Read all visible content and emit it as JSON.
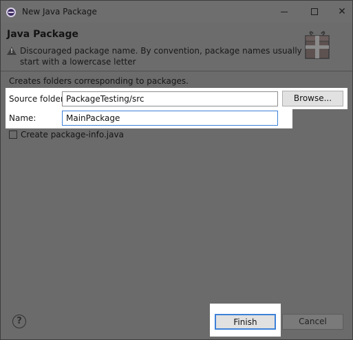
{
  "window": {
    "title": "New Java Package"
  },
  "header": {
    "title": "Java Package",
    "message": "Discouraged package name. By convention, package names usually start with a lowercase letter"
  },
  "body": {
    "description": "Creates folders corresponding to packages.",
    "source_folder_label": "Source folder:",
    "source_folder_value": "PackageTesting/src",
    "browse_label": "Browse...",
    "name_label": "Name:",
    "name_value": "MainPackage",
    "create_package_info_label": "Create package-info.java",
    "create_package_info_checked": false
  },
  "footer": {
    "finish_label": "Finish",
    "cancel_label": "Cancel"
  },
  "icons": {
    "app": "eclipse-icon",
    "warning": "warning-icon",
    "wizard": "package-graphic",
    "help": "help-icon"
  },
  "colors": {
    "highlight": "#ffffff",
    "focus_border": "#3c7fd8",
    "dim_background": "#6b6b6b"
  }
}
